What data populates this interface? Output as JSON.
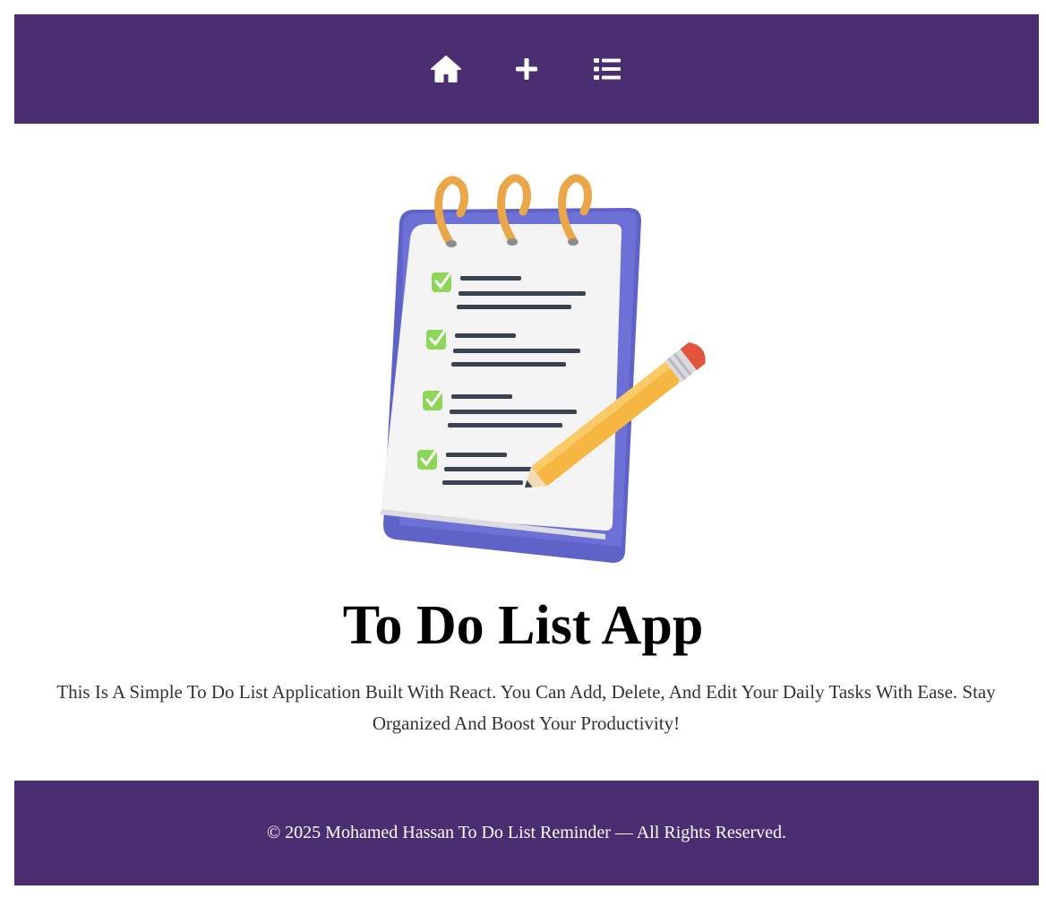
{
  "nav": {
    "items": [
      {
        "icon": "home-icon",
        "name": "home-nav-button"
      },
      {
        "icon": "plus-icon",
        "name": "add-task-nav-button"
      },
      {
        "icon": "list-icon",
        "name": "task-list-nav-button"
      }
    ],
    "background": "#4b2e72",
    "icon_color": "#ffffff"
  },
  "hero": {
    "image": "clipboard-checklist-with-pencil-illustration"
  },
  "main": {
    "title": "To Do List App",
    "description": "This Is A Simple To Do List Application Built With React. You Can Add, Delete, And Edit Your Daily Tasks With Ease. Stay Organized And Boost Your Productivity!"
  },
  "footer": {
    "text": "© 2025 Mohamed Hassan To Do List Reminder — All Rights Reserved."
  }
}
